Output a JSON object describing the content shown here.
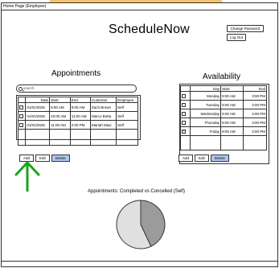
{
  "window": {
    "title": "Home Page (Employee)"
  },
  "app": {
    "title": "ScheduleNow"
  },
  "header": {
    "change_password": "Change Password",
    "log_out": "Log Out"
  },
  "appointments": {
    "title": "Appointments",
    "search_placeholder": "search",
    "columns": [
      "Date",
      "Start",
      "End",
      "Customer",
      "Employee"
    ],
    "rows": [
      {
        "date": "01/01/2025",
        "start": "8:00 AM",
        "end": "9:00 AM",
        "customer": "Zach Brown",
        "employee": "Self"
      },
      {
        "date": "01/01/2025",
        "start": "10:00 AM",
        "end": "11:00 AM",
        "customer": "Marco Botta",
        "employee": "Self"
      },
      {
        "date": "01/01/2025",
        "start": "11:00 AM",
        "end": "2:00 PM",
        "customer": "Mariah Maxi",
        "employee": "Self"
      }
    ],
    "buttons": {
      "add": "Add",
      "edit": "Edit",
      "delete": "Delete"
    }
  },
  "availability": {
    "title": "Availability",
    "columns": [
      "Day",
      "Start",
      "End"
    ],
    "rows": [
      {
        "day": "Monday",
        "start": "9:00 AM",
        "end": "3:00 PM",
        "checked": false
      },
      {
        "day": "Tuesday",
        "start": "9:00 AM",
        "end": "3:00 PM",
        "checked": false
      },
      {
        "day": "Wednesday",
        "start": "9:00 AM",
        "end": "3:00 PM",
        "checked": false
      },
      {
        "day": "Thursday",
        "start": "9:00 AM",
        "end": "3:00 PM",
        "checked": false
      },
      {
        "day": "Friday",
        "start": "9:00 AM",
        "end": "3:00 PM",
        "checked": true
      }
    ],
    "buttons": {
      "add": "Add",
      "edit": "Edit",
      "delete": "Delete"
    }
  },
  "chart_data": {
    "type": "pie",
    "title": "Appointments: Completed vs Concelled (Self)",
    "values": [
      43,
      57
    ],
    "colors": [
      "#9b9b9b",
      "#e0e0e0"
    ]
  },
  "colors": {
    "accent": "#f5c46a",
    "delete_button": "#aec8f0",
    "arrow": "#1aa31a"
  },
  "icons": {
    "search": "search-icon",
    "arrow": "up-arrow-icon"
  }
}
